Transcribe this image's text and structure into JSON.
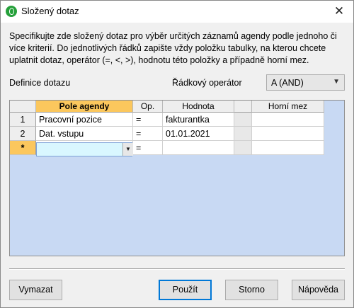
{
  "window": {
    "title": "Složený dotaz",
    "close_glyph": "✕"
  },
  "description": "Specifikujte zde složený dotaz pro výběr určitých záznamů agendy podle jednoho či více kriterií. Do jednotlivých řádků zapište vždy položku tabulky, na kterou chcete uplatnit dotaz, operátor (=, <, >), hodnotu této položky a případně horní mez.",
  "labels": {
    "definition": "Definice dotazu",
    "row_operator": "Řádkový operátor"
  },
  "row_operator_select": {
    "value": "A (AND)"
  },
  "grid": {
    "columns": [
      "Pole agendy",
      "Op.",
      "Hodnota",
      "",
      "Horní mez"
    ],
    "rows": [
      {
        "num": "1",
        "field": "Pracovní pozice",
        "op": "=",
        "value": "fakturantka",
        "upper": ""
      },
      {
        "num": "2",
        "field": "Dat. vstupu",
        "op": "=",
        "value": "01.01.2021",
        "upper": ""
      }
    ],
    "new_row": {
      "marker": "*",
      "field": "",
      "op": "="
    }
  },
  "buttons": {
    "clear": "Vymazat",
    "use": "Použít",
    "cancel": "Storno",
    "help": "Nápověda"
  },
  "icons": {
    "app": "app-icon",
    "close": "close-icon",
    "dropdown": "chevron-down-icon"
  },
  "colors": {
    "active_header": "#fbc75d",
    "grid_background": "#c8d9f3",
    "editing_cell": "#d9f7ff",
    "default_button_border": "#0078d7"
  }
}
